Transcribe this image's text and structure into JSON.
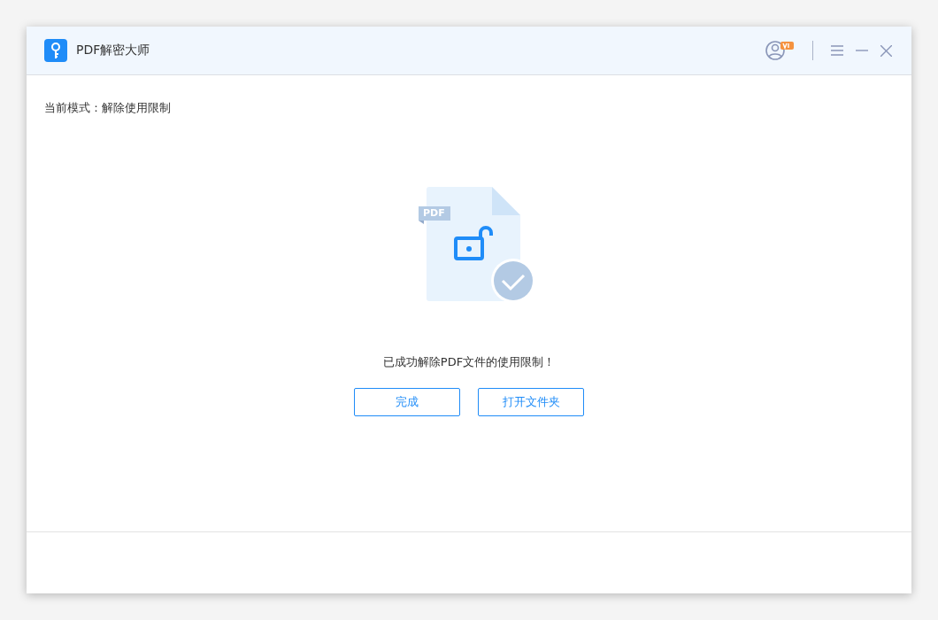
{
  "window": {
    "title": "PDF解密大师"
  },
  "mode": {
    "label": "当前模式：解除使用限制"
  },
  "illustration": {
    "tag": "PDF"
  },
  "message": "已成功解除PDF文件的使用限制！",
  "buttons": [
    {
      "label": "完成"
    },
    {
      "label": "打开文件夹"
    }
  ]
}
